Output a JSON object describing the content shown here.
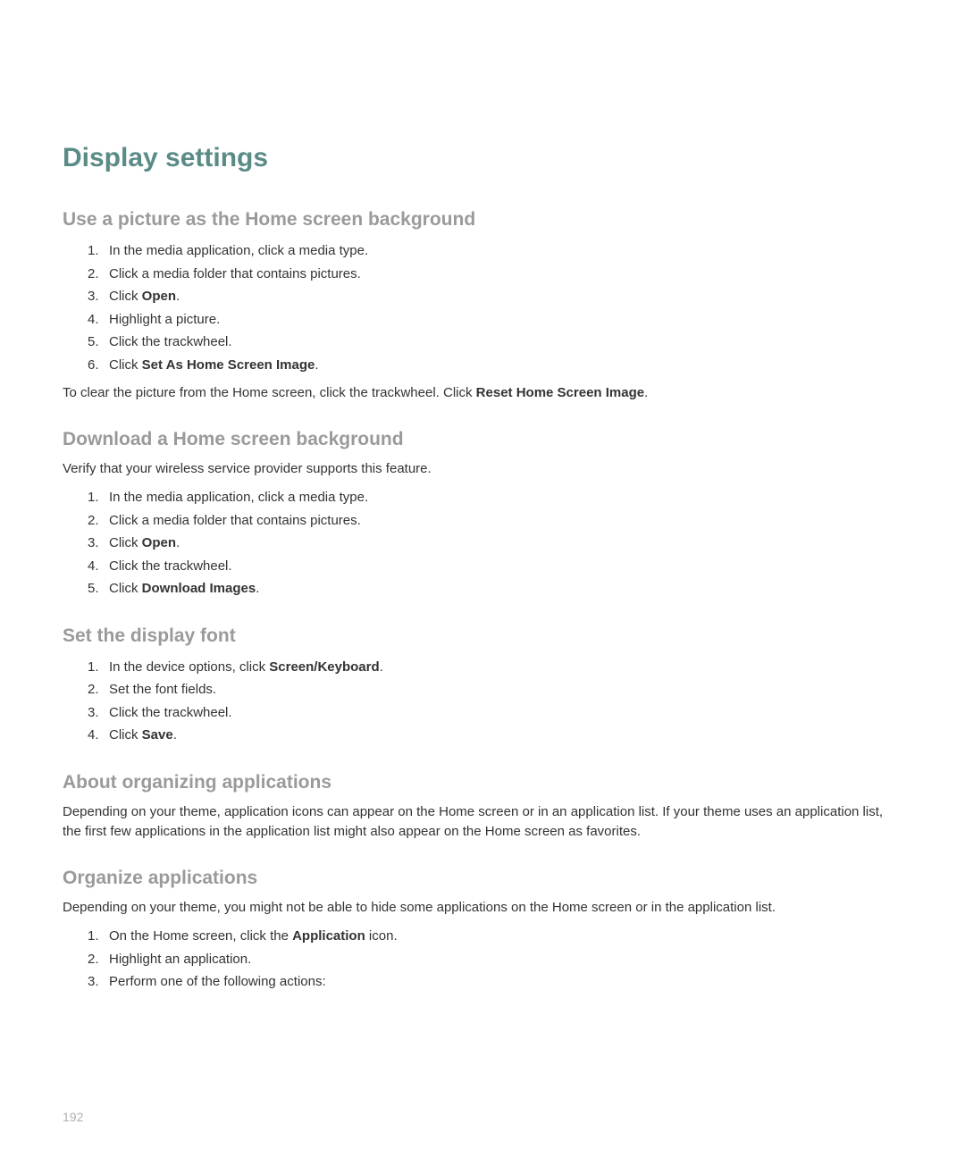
{
  "page_number": "192",
  "main_title": "Display settings",
  "sections": [
    {
      "title": "Use a picture as the Home screen background",
      "steps": [
        {
          "text": "In the media application, click a media type."
        },
        {
          "text": "Click a media folder that contains pictures."
        },
        {
          "prefix": "Click ",
          "bold": "Open",
          "suffix": "."
        },
        {
          "text": "Highlight a picture."
        },
        {
          "text": "Click the trackwheel."
        },
        {
          "prefix": "Click ",
          "bold": "Set As Home Screen Image",
          "suffix": "."
        }
      ],
      "note_prefix": "To clear the picture from the Home screen, click the trackwheel. Click ",
      "note_bold": "Reset Home Screen Image",
      "note_suffix": "."
    },
    {
      "title": "Download a Home screen background",
      "intro": "Verify that your wireless service provider supports this feature.",
      "steps": [
        {
          "text": "In the media application, click a media type."
        },
        {
          "text": "Click a media folder that contains pictures."
        },
        {
          "prefix": "Click ",
          "bold": "Open",
          "suffix": "."
        },
        {
          "text": "Click the trackwheel."
        },
        {
          "prefix": "Click ",
          "bold": "Download Images",
          "suffix": "."
        }
      ]
    },
    {
      "title": "Set the display font",
      "steps": [
        {
          "prefix": "In the device options, click ",
          "bold": "Screen/Keyboard",
          "suffix": "."
        },
        {
          "text": "Set the font fields."
        },
        {
          "text": "Click the trackwheel."
        },
        {
          "prefix": "Click ",
          "bold": "Save",
          "suffix": "."
        }
      ]
    },
    {
      "title": "About organizing applications",
      "intro": "Depending on your theme, application icons can appear on the Home screen or in an application list. If your theme uses an application list, the first few applications in the application list might also appear on the Home screen as favorites."
    },
    {
      "title": "Organize applications",
      "intro": "Depending on your theme, you might not be able to hide some applications on the Home screen or in the application list.",
      "steps": [
        {
          "prefix": "On the Home screen, click the ",
          "bold": "Application",
          "suffix": " icon."
        },
        {
          "text": "Highlight an application."
        },
        {
          "text": "Perform one of the following actions:"
        }
      ]
    }
  ]
}
